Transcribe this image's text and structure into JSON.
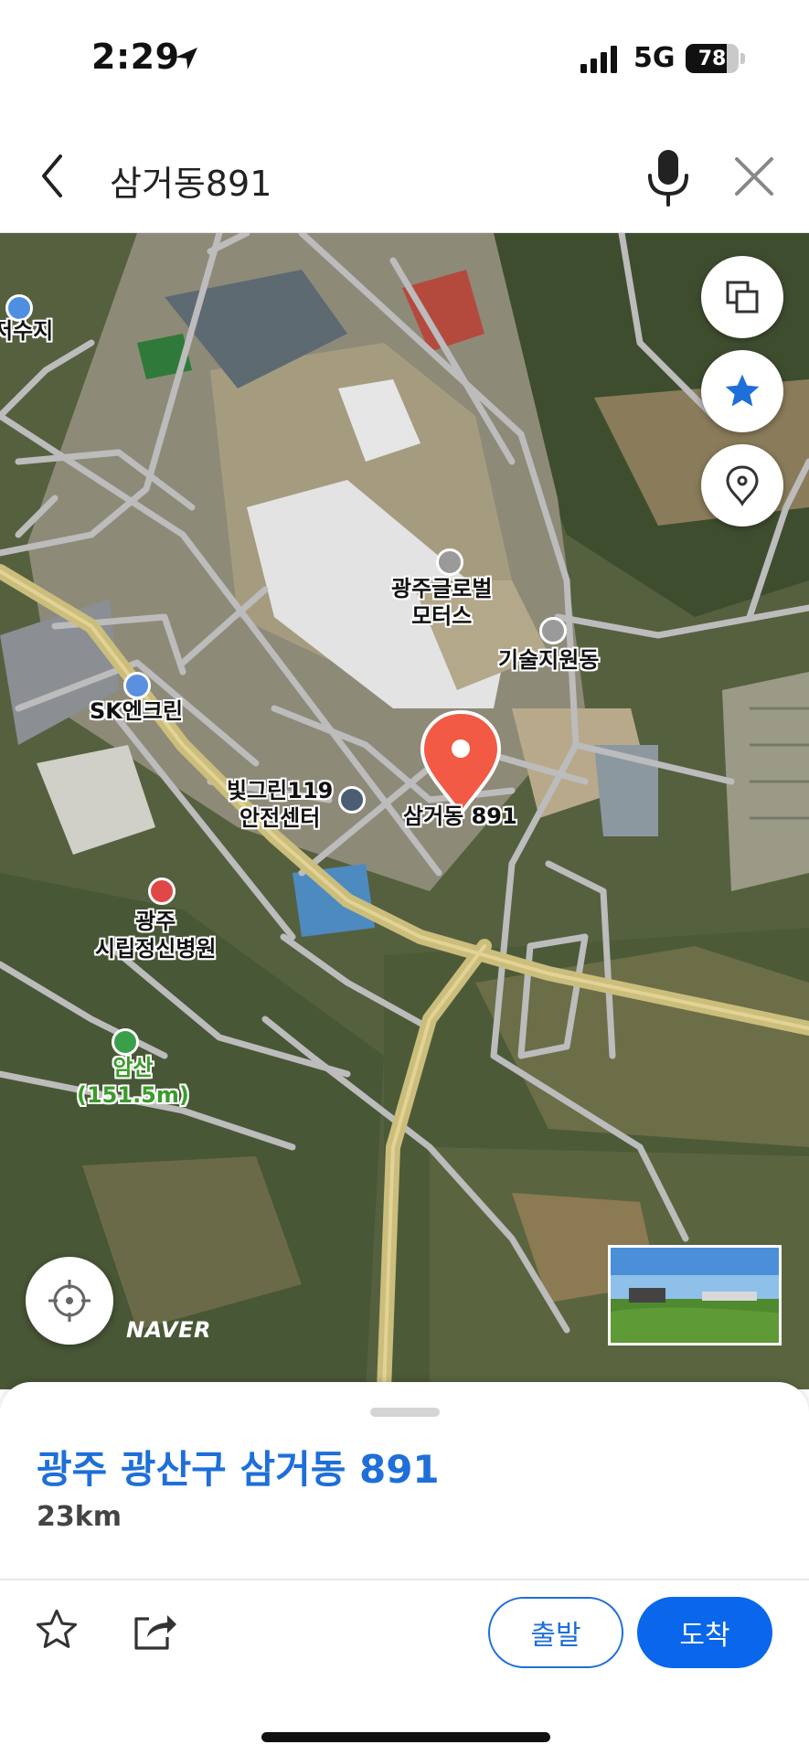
{
  "status": {
    "time": "2:29",
    "network": "5G",
    "battery": "78"
  },
  "search": {
    "query": "삼거동891"
  },
  "map": {
    "labels": {
      "reservoir": "저수지",
      "global_motors": "광주글로벌\n모터스",
      "tech_support": "기술지원동",
      "sk_encrean": "SK엔크린",
      "safety_center": "빛그린119\n안전센터",
      "pin_label": "삼거동 891",
      "hospital": "광주\n시립정신병원",
      "mountain": "암산\n(151.5m)"
    },
    "logo": "NAVER"
  },
  "sheet": {
    "address": "광주 광산구 삼거동 891",
    "distance": "23km",
    "depart_label": "출발",
    "arrive_label": "도착"
  },
  "colors": {
    "accent": "#0a66ea",
    "address": "#1e6fd9",
    "pin": "#f25a45"
  }
}
